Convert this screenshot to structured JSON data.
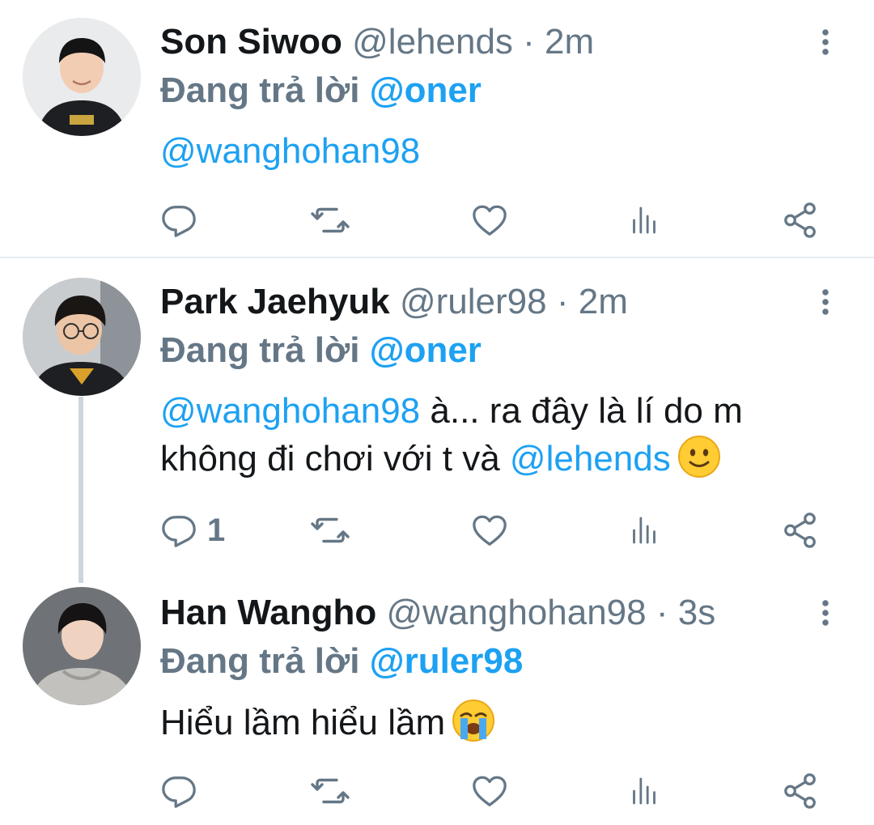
{
  "colors": {
    "accent": "#1da1f2",
    "secondary": "#657786",
    "text": "#14171a",
    "divider": "#e6ecf0"
  },
  "tweets": [
    {
      "name": "Son Siwoo",
      "handle": "@lehends",
      "dot": "·",
      "time": "2m",
      "replying_prefix": "Đang trả lời",
      "replying_to": "@oner",
      "body": [
        {
          "link": "@wanghohan98"
        }
      ],
      "reply_count": ""
    },
    {
      "name": "Park Jaehyuk",
      "handle": "@ruler98",
      "dot": "·",
      "time": "2m",
      "replying_prefix": "Đang trả lời",
      "replying_to": "@oner",
      "body_line1_link": "@wanghohan98",
      "body_line1_text": " à... ra đây là lí do m",
      "body_line2_text": "không đi chơi với t và ",
      "body_line2_link": "@lehends",
      "emoji": "slightly-smiling-face",
      "reply_count": "1"
    },
    {
      "name": "Han Wangho",
      "handle": "@wanghohan98",
      "dot": "·",
      "time": "3s",
      "replying_prefix": "Đang trả lời",
      "replying_to": "@ruler98",
      "body_text": "Hiểu lầm hiểu lầm",
      "emoji": "loudly-crying-face",
      "reply_count": ""
    }
  ],
  "icons": {
    "reply": "reply-icon",
    "retweet": "retweet-icon",
    "like": "heart-icon",
    "analytics": "analytics-icon",
    "share": "share-icon",
    "more": "more-vertical-icon"
  }
}
